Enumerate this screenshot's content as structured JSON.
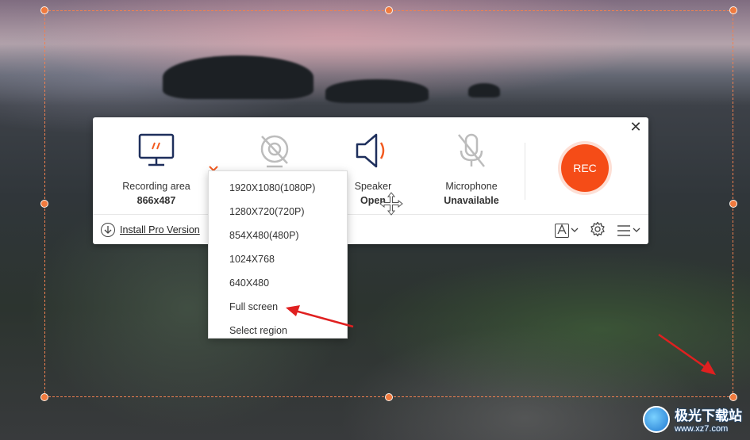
{
  "toolbar": {
    "recording_area": {
      "label": "Recording area",
      "value": "866x487"
    },
    "speaker": {
      "label": "Speaker",
      "value": "Open"
    },
    "microphone": {
      "label": "Microphone",
      "value": "Unavailable"
    },
    "rec_label": "REC",
    "install_label": "Install Pro Version",
    "accent_color": "#f54c17"
  },
  "resolution_menu": {
    "items": [
      "1920X1080(1080P)",
      "1280X720(720P)",
      "854X480(480P)",
      "1024X768",
      "640X480",
      "Full screen",
      "Select region"
    ]
  },
  "watermark": {
    "name": "极光下载站",
    "url": "www.xz7.com"
  },
  "icons": [
    "monitor-icon",
    "webcam-off-icon",
    "speaker-icon",
    "microphone-off-icon",
    "close-icon",
    "download-icon",
    "text-style-icon",
    "gear-icon",
    "menu-icon",
    "move-cursor-icon"
  ]
}
